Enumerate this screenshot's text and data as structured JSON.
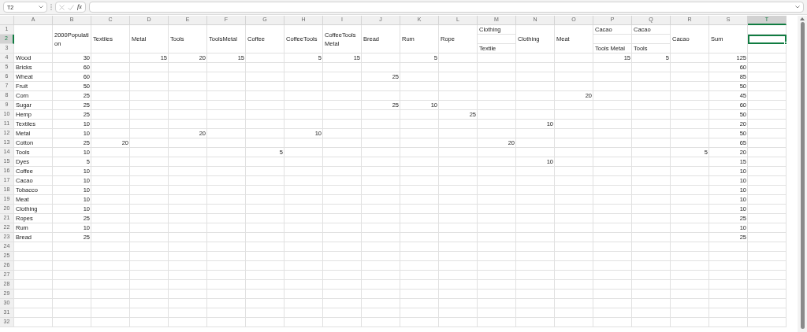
{
  "name_box": {
    "value": "T2"
  },
  "formula_bar": {
    "label": "fx"
  },
  "columns": [
    {
      "label": "A",
      "selected": false
    },
    {
      "label": "B",
      "selected": false
    },
    {
      "label": "C",
      "selected": false
    },
    {
      "label": "D",
      "selected": false
    },
    {
      "label": "E",
      "selected": false
    },
    {
      "label": "F",
      "selected": false
    },
    {
      "label": "G",
      "selected": false
    },
    {
      "label": "H",
      "selected": false
    },
    {
      "label": "I",
      "selected": false
    },
    {
      "label": "J",
      "selected": false
    },
    {
      "label": "K",
      "selected": false
    },
    {
      "label": "L",
      "selected": false
    },
    {
      "label": "M",
      "selected": false
    },
    {
      "label": "N",
      "selected": false
    },
    {
      "label": "O",
      "selected": false
    },
    {
      "label": "P",
      "selected": false
    },
    {
      "label": "Q",
      "selected": false
    },
    {
      "label": "R",
      "selected": false
    },
    {
      "label": "S",
      "selected": false
    },
    {
      "label": "T",
      "selected": true
    }
  ],
  "row_headers": [
    {
      "label": "1",
      "selected": false
    },
    {
      "label": "2",
      "selected": true
    },
    {
      "label": "3",
      "selected": false
    },
    {
      "label": "4",
      "selected": false
    },
    {
      "label": "5",
      "selected": false
    },
    {
      "label": "6",
      "selected": false
    },
    {
      "label": "7",
      "selected": false
    },
    {
      "label": "8",
      "selected": false
    },
    {
      "label": "9",
      "selected": false
    },
    {
      "label": "10",
      "selected": false
    },
    {
      "label": "11",
      "selected": false
    },
    {
      "label": "12",
      "selected": false
    },
    {
      "label": "13",
      "selected": false
    },
    {
      "label": "14",
      "selected": false
    },
    {
      "label": "15",
      "selected": false
    },
    {
      "label": "16",
      "selected": false
    },
    {
      "label": "17",
      "selected": false
    },
    {
      "label": "18",
      "selected": false
    },
    {
      "label": "19",
      "selected": false
    },
    {
      "label": "20",
      "selected": false
    },
    {
      "label": "21",
      "selected": false
    },
    {
      "label": "22",
      "selected": false
    },
    {
      "label": "23",
      "selected": false
    },
    {
      "label": "24",
      "selected": false
    },
    {
      "label": "25",
      "selected": false
    },
    {
      "label": "26",
      "selected": false
    },
    {
      "label": "27",
      "selected": false
    },
    {
      "label": "28",
      "selected": false
    },
    {
      "label": "29",
      "selected": false
    },
    {
      "label": "30",
      "selected": false
    },
    {
      "label": "31",
      "selected": false
    },
    {
      "label": "32",
      "selected": false
    }
  ],
  "header_cells": [
    {
      "text": "2000Population"
    },
    {
      "text": "Textiles"
    },
    {
      "text": "Metal"
    },
    {
      "text": "Tools"
    },
    {
      "text": "ToolsMetal"
    },
    {
      "text": "Coffee"
    },
    {
      "text": "CoffeeTools"
    },
    {
      "text": "CoffeeTools Metal"
    },
    {
      "text": "Bread"
    },
    {
      "text": "Rum"
    },
    {
      "text": "Rope"
    },
    {
      "top": "Clothing",
      "bottom": "Textile"
    },
    {
      "text": "Clothing"
    },
    {
      "text": "Meat"
    },
    {
      "top": "Cacao",
      "bottom": "Tools Metal"
    },
    {
      "top": "Cacao",
      "bottom": "Tools"
    },
    {
      "text": "Cacao"
    },
    {
      "text": "Sum"
    }
  ],
  "data_rows": [
    {
      "name": "Wood",
      "values": {
        "B": "30",
        "D": "15",
        "E": "20",
        "F": "15",
        "H": "5",
        "I": "15",
        "K": "5",
        "P": "15",
        "Q": "5",
        "S": "125"
      }
    },
    {
      "name": "Bricks",
      "values": {
        "B": "60",
        "S": "60"
      }
    },
    {
      "name": "Wheat",
      "values": {
        "B": "60",
        "J": "25",
        "S": "85"
      }
    },
    {
      "name": "Fruit",
      "values": {
        "B": "50",
        "S": "50"
      }
    },
    {
      "name": "Corn",
      "values": {
        "B": "25",
        "O": "20",
        "S": "45"
      }
    },
    {
      "name": "Sugar",
      "values": {
        "B": "25",
        "J": "25",
        "K": "10",
        "S": "60"
      }
    },
    {
      "name": "Hemp",
      "values": {
        "B": "25",
        "L": "25",
        "S": "50"
      }
    },
    {
      "name": "Textiles",
      "values": {
        "B": "10",
        "N": "10",
        "S": "20"
      }
    },
    {
      "name": "Metal",
      "values": {
        "B": "10",
        "E": "20",
        "H": "10",
        "S": "50"
      }
    },
    {
      "name": "Cotton",
      "values": {
        "B": "25",
        "C": "20",
        "M": "20",
        "S": "65"
      }
    },
    {
      "name": "Tools",
      "values": {
        "B": "10",
        "G": "5",
        "R": "5",
        "S": "20"
      }
    },
    {
      "name": "Dyes",
      "values": {
        "B": "5",
        "N": "10",
        "S": "15"
      }
    },
    {
      "name": "Coffee",
      "values": {
        "B": "10",
        "S": "10"
      }
    },
    {
      "name": "Cacao",
      "values": {
        "B": "10",
        "S": "10"
      }
    },
    {
      "name": "Tobacco",
      "values": {
        "B": "10",
        "S": "10"
      }
    },
    {
      "name": "Meat",
      "values": {
        "B": "10",
        "S": "10"
      }
    },
    {
      "name": "Clothing",
      "values": {
        "B": "10",
        "S": "10"
      }
    },
    {
      "name": "Ropes",
      "values": {
        "B": "25",
        "S": "25"
      }
    },
    {
      "name": "Rum",
      "values": {
        "B": "10",
        "S": "10"
      }
    },
    {
      "name": "Bread",
      "values": {
        "B": "25",
        "S": "25"
      }
    }
  ]
}
